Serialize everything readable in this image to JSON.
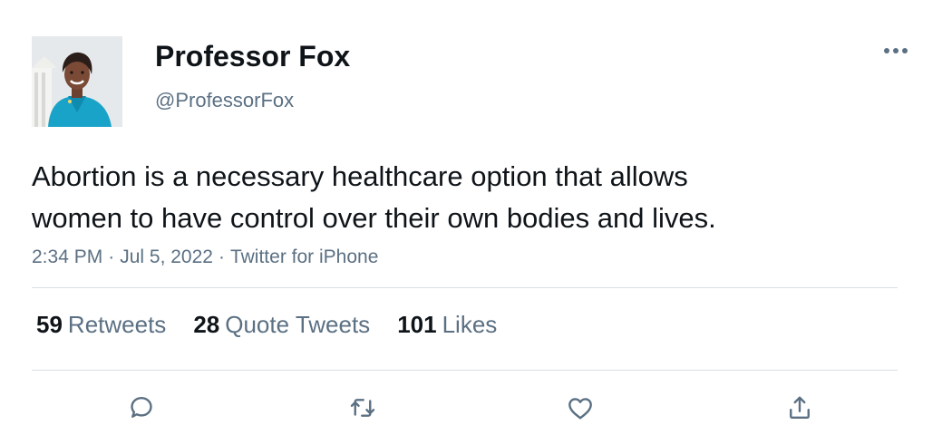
{
  "author": {
    "display_name": "Professor Fox",
    "handle": "@ProfessorFox",
    "avatar_icon": "profile-photo"
  },
  "tweet": {
    "text": "Abortion is a necessary healthcare option that allows\nwomen to have control over their own bodies and lives.",
    "time": "2:34 PM",
    "date": "Jul 5, 2022",
    "source": "Twitter for iPhone",
    "separator": "·"
  },
  "stats": {
    "retweets_count": "59",
    "retweets_label": "Retweets",
    "quote_tweets_count": "28",
    "quote_tweets_label": "Quote Tweets",
    "likes_count": "101",
    "likes_label": "Likes"
  },
  "actions": {
    "reply_icon": "reply-icon",
    "retweet_icon": "retweet-icon",
    "like_icon": "heart-icon",
    "share_icon": "share-icon"
  },
  "colors": {
    "text_primary": "#0f1419",
    "text_secondary": "#5b7083",
    "divider": "#d9dee3",
    "icon": "#5b7083"
  }
}
